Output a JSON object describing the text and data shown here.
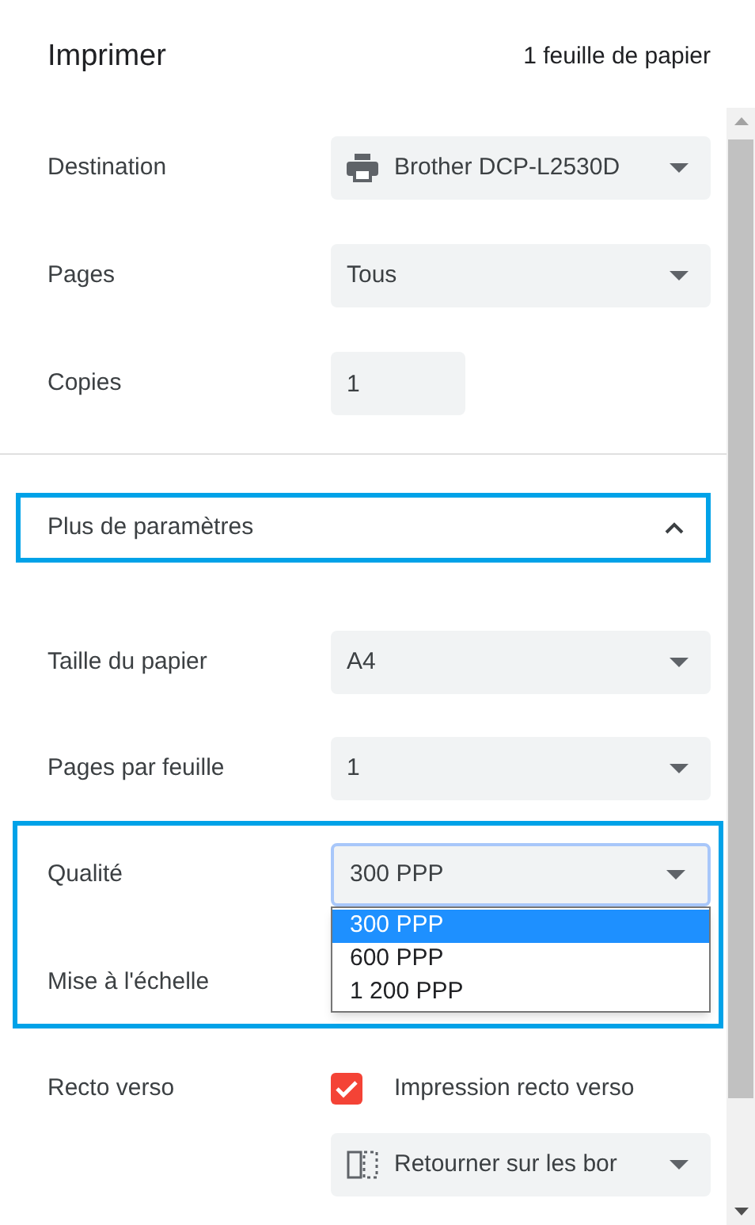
{
  "header": {
    "title": "Imprimer",
    "summary": "1 feuille de papier"
  },
  "main_settings": [
    {
      "label": "Destination",
      "kind": "select",
      "value": "Brother DCP-L2530D"
    },
    {
      "label": "Pages",
      "kind": "select",
      "value": "Tous"
    },
    {
      "label": "Copies",
      "kind": "input",
      "value": "1"
    }
  ],
  "more_settings": {
    "label": "Plus de paramètres",
    "expanded": true,
    "highlighted": true
  },
  "extra_settings": [
    {
      "label": "Taille du papier",
      "kind": "select",
      "value": "A4"
    },
    {
      "label": "Pages par feuille",
      "kind": "select",
      "value": "1"
    }
  ],
  "quality_group": {
    "highlighted": true,
    "label": "Qualité",
    "value": "300 PPP",
    "focused": true,
    "options": [
      {
        "label": "300 PPP",
        "selected": true
      },
      {
        "label": "600 PPP",
        "selected": false
      },
      {
        "label": "1 200 PPP",
        "selected": false
      }
    ],
    "scaling_label": "Mise à l'échelle"
  },
  "duplex": {
    "label": "Recto verso",
    "checked": true,
    "checkbox_label": "Impression recto verso",
    "mode": "Retourner sur les bor"
  }
}
